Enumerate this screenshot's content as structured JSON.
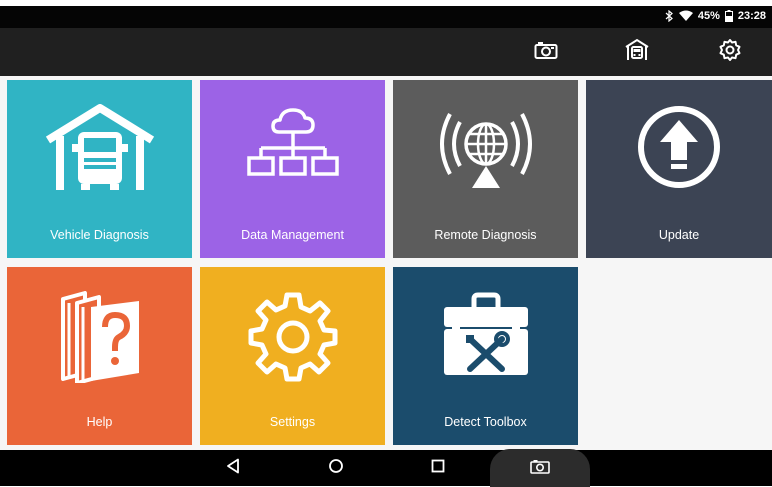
{
  "status_bar": {
    "battery": "45%",
    "time": "23:28",
    "icons": [
      "bluetooth-icon",
      "wifi-icon",
      "battery-charging-icon"
    ]
  },
  "toolbar": {
    "buttons": [
      "screenshot-camera-icon",
      "garage-vehicle-icon",
      "settings-gear-icon"
    ]
  },
  "tiles": [
    {
      "label": "Vehicle Diagnosis",
      "color": "#30b4c4",
      "icon": "garage-truck-icon"
    },
    {
      "label": "Data Management",
      "color": "#9c63e6",
      "icon": "cloud-network-icon"
    },
    {
      "label": "Remote Diagnosis",
      "color": "#5c5c5c",
      "icon": "globe-broadcast-icon"
    },
    {
      "label": "Update",
      "color": "#3c4454",
      "icon": "upload-arrow-icon"
    },
    {
      "label": "Help",
      "color": "#ea6538",
      "icon": "help-books-icon"
    },
    {
      "label": "Settings",
      "color": "#f0af20",
      "icon": "gear-icon"
    },
    {
      "label": "Detect Toolbox",
      "color": "#1b4c6c",
      "icon": "toolbox-icon"
    }
  ],
  "navigation": {
    "buttons": [
      "back-icon",
      "home-icon",
      "recents-icon",
      "screenshot-camera-icon"
    ]
  }
}
